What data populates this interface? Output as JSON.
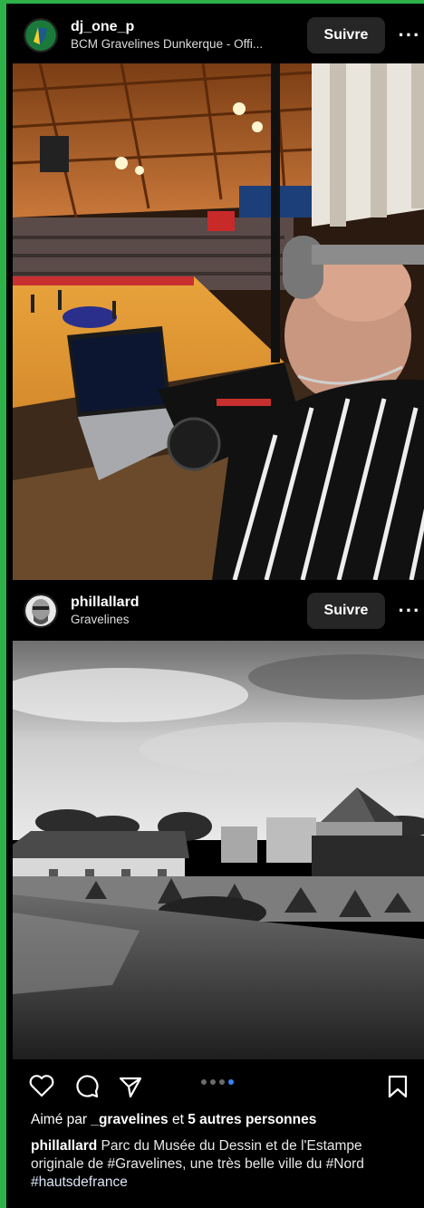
{
  "post1": {
    "username": "dj_one_p",
    "subtitle": "BCM Gravelines Dunkerque - Offi...",
    "follow_label": "Suivre",
    "more_icon": "more-horizontal-icon"
  },
  "post2": {
    "username": "phillallard",
    "subtitle": "Gravelines",
    "follow_label": "Suivre",
    "more_icon": "more-horizontal-icon",
    "carousel": {
      "count": 4,
      "active_index": 3
    },
    "likes_prefix": "Aimé par ",
    "likes_user": "_gravelines",
    "likes_mid": " et ",
    "likes_count": "5 autres personnes",
    "caption_user": "phillallard",
    "caption_text": " Parc du Musée du Dessin et de l'Estampe originale de #Gravelines, une très belle ville du #Nord",
    "hashtag": "#hautsdefrance"
  },
  "icons": [
    "heart-icon",
    "comment-icon",
    "share-icon",
    "bookmark-icon"
  ],
  "colors": {
    "frame_border": "#2fb14a",
    "carousel_active": "#3b82f6",
    "button_bg": "#262626"
  }
}
